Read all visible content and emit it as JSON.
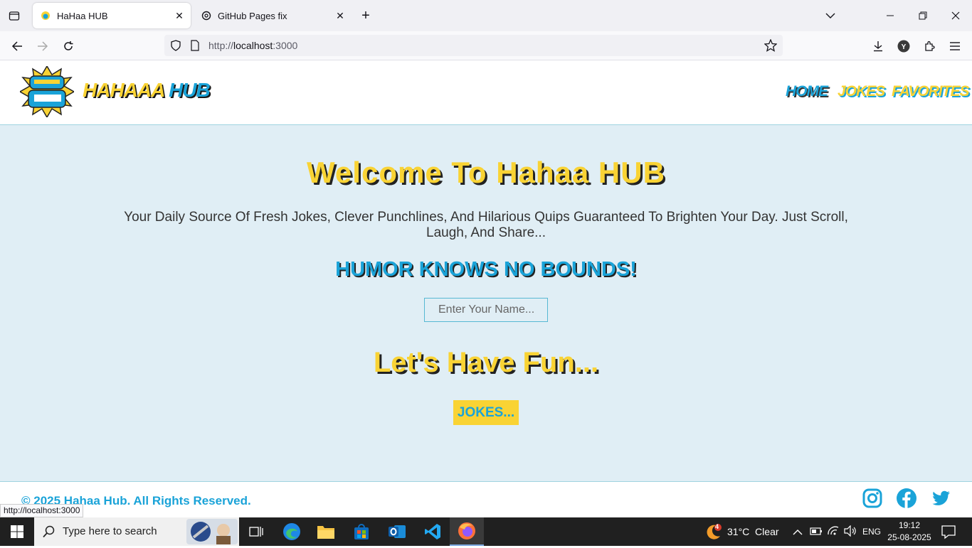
{
  "browser": {
    "tabs": [
      {
        "title": "HaHaa HUB",
        "active": true
      },
      {
        "title": "GitHub Pages fix",
        "active": false
      }
    ],
    "url_prefix": "http://",
    "url_host": "localhost",
    "url_suffix": ":3000",
    "status_url": "http://localhost:3000"
  },
  "site": {
    "brand_first": "HAHAAA",
    "brand_second": "HUB",
    "nav": {
      "home": "HOME",
      "jokes": "JOKES",
      "favorites": "FAVORITES"
    },
    "welcome": "Welcome To Hahaa HUB",
    "tagline": "Your Daily Source Of Fresh Jokes, Clever Punchlines, And Hilarious Quips Guaranteed To Brighten Your Day. Just Scroll, Laugh, And Share...",
    "humor": "HUMOR KNOWS NO BOUNDS!",
    "name_placeholder": "Enter Your Name...",
    "fun": "Let's Have Fun...",
    "jokes_button": "JOKES...",
    "copyright": "© 2025 Hahaa Hub. All Rights Reserved.",
    "colors": {
      "yellow": "#f9d334",
      "blue": "#1aa3d8",
      "bg": "#e0eef5"
    }
  },
  "taskbar": {
    "search_placeholder": "Type here to search",
    "weather_badge": "4",
    "weather": "31°C  Clear",
    "language": "ENG",
    "time": "19:12",
    "date": "25-08-2025"
  }
}
